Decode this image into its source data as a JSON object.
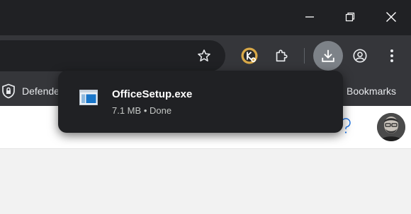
{
  "bookmarks": {
    "item1_label": "Defende",
    "item2_label": "Bookmarks"
  },
  "download_popup": {
    "file_name": "OfficeSetup.exe",
    "size": "7.1 MB",
    "separator": "•",
    "status": "Done"
  },
  "icons": [
    "minimize-icon",
    "restore-icon",
    "close-icon",
    "star-icon",
    "password-manager-extension-icon",
    "extensions-icon",
    "download-icon",
    "profile-icon",
    "more-menu-icon",
    "shield-icon",
    "windows-exe-file-icon",
    "help-icon"
  ],
  "colors": {
    "titlebar": "#202124",
    "toolbar": "#35363a",
    "download_button_active": "#7d8288",
    "popup": "#202124"
  }
}
